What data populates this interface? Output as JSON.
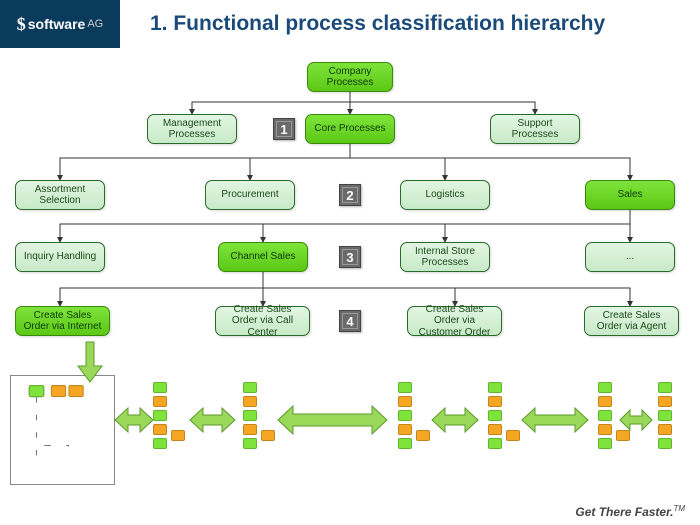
{
  "header": {
    "logo_text": "software",
    "logo_suffix": "AG",
    "title": "1. Functional process classification hierarchy"
  },
  "nodes": {
    "r0": "Company Processes",
    "r1a": "Management Processes",
    "r1b": "Core Processes",
    "r1c": "Support Processes",
    "r2a": "Assortment Selection",
    "r2b": "Procurement",
    "r2c": "Logistics",
    "r2d": "Sales",
    "r3a": "Inquiry Handling",
    "r3b": "Channel Sales",
    "r3c": "Internal Store Processes",
    "r3d": "...",
    "r4a": "Create Sales Order via Internet",
    "r4b": "Create Sales Order via Call Center",
    "r4c": "Create Sales Order via Customer Order",
    "r4d": "Create Sales Order via Agent"
  },
  "badges": {
    "b1": "1",
    "b2": "2",
    "b3": "3",
    "b4": "4"
  },
  "footer": {
    "tagline": "Get There Faster.",
    "tm": "TM"
  },
  "colors": {
    "accent_green": "#7ee33a",
    "mint": "#c8eac8",
    "badge": "#6a6a6a",
    "brand_blue": "#0a3a5c"
  },
  "chart_data": {
    "type": "tree",
    "title": "Functional process classification hierarchy",
    "levels": [
      {
        "level": 0,
        "items": [
          {
            "id": "r0",
            "label": "Company Processes",
            "highlighted": true
          }
        ]
      },
      {
        "level": 1,
        "badge": 1,
        "items": [
          {
            "id": "r1a",
            "label": "Management Processes",
            "highlighted": false
          },
          {
            "id": "r1b",
            "label": "Core Processes",
            "highlighted": true
          },
          {
            "id": "r1c",
            "label": "Support Processes",
            "highlighted": false
          }
        ]
      },
      {
        "level": 2,
        "badge": 2,
        "items": [
          {
            "id": "r2a",
            "label": "Assortment Selection",
            "highlighted": false
          },
          {
            "id": "r2b",
            "label": "Procurement",
            "highlighted": false
          },
          {
            "id": "r2c",
            "label": "Logistics",
            "highlighted": false
          },
          {
            "id": "r2d",
            "label": "Sales",
            "highlighted": true
          }
        ]
      },
      {
        "level": 3,
        "badge": 3,
        "items": [
          {
            "id": "r3a",
            "label": "Inquiry Handling",
            "highlighted": false
          },
          {
            "id": "r3b",
            "label": "Channel Sales",
            "highlighted": true
          },
          {
            "id": "r3c",
            "label": "Internal Store Processes",
            "highlighted": false
          },
          {
            "id": "r3d",
            "label": "...",
            "highlighted": false
          }
        ]
      },
      {
        "level": 4,
        "badge": 4,
        "items": [
          {
            "id": "r4a",
            "label": "Create Sales Order via Internet",
            "highlighted": true
          },
          {
            "id": "r4b",
            "label": "Create Sales Order via Call Center",
            "highlighted": false
          },
          {
            "id": "r4c",
            "label": "Create Sales Order via Customer Order",
            "highlighted": false
          },
          {
            "id": "r4d",
            "label": "Create Sales Order via Agent",
            "highlighted": false
          }
        ]
      }
    ],
    "edges": [
      [
        "r0",
        "r1a"
      ],
      [
        "r0",
        "r1b"
      ],
      [
        "r0",
        "r1c"
      ],
      [
        "r1b",
        "r2a"
      ],
      [
        "r1b",
        "r2b"
      ],
      [
        "r1b",
        "r2c"
      ],
      [
        "r1b",
        "r2d"
      ],
      [
        "r2d",
        "r3a"
      ],
      [
        "r2d",
        "r3b"
      ],
      [
        "r2d",
        "r3c"
      ],
      [
        "r2d",
        "r3d"
      ],
      [
        "r3b",
        "r4a"
      ],
      [
        "r3b",
        "r4b"
      ],
      [
        "r3b",
        "r4c"
      ],
      [
        "r3b",
        "r4d"
      ]
    ],
    "highlighted_path": [
      "r0",
      "r1b",
      "r2d",
      "r3b",
      "r4a"
    ],
    "bottom_note": "Row of detailed mini process flowcharts with bidirectional arrows; leftmost expanded in callout box"
  }
}
